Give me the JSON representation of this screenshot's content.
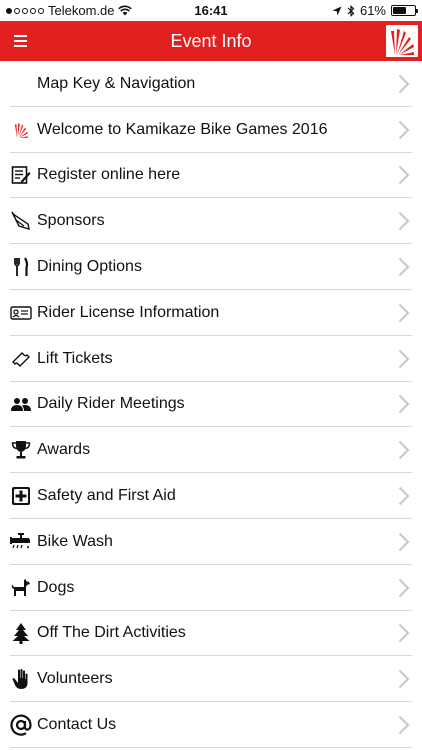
{
  "status_bar": {
    "carrier": "Telekom.de",
    "signal_bars": 1,
    "time": "16:41",
    "battery_percent_label": "61%",
    "battery_level": 0.61
  },
  "nav": {
    "title": "Event Info",
    "menu_icon": "hamburger-icon",
    "logo_icon": "kamikaze-logo-icon"
  },
  "colors": {
    "nav_background": "#e2201f",
    "chevron": "#c8c8c8"
  },
  "items": [
    {
      "label": "Map Key & Navigation",
      "icon": "none"
    },
    {
      "label": "Welcome to Kamikaze Bike Games 2016",
      "icon": "kamikaze-logo-icon"
    },
    {
      "label": "Register online here",
      "icon": "form-icon"
    },
    {
      "label": "Sponsors",
      "icon": "megaphone-icon"
    },
    {
      "label": "Dining Options",
      "icon": "fork-knife-icon"
    },
    {
      "label": "Rider License Information",
      "icon": "id-card-icon"
    },
    {
      "label": "Lift Tickets",
      "icon": "ticket-icon"
    },
    {
      "label": "Daily Rider Meetings",
      "icon": "people-icon"
    },
    {
      "label": "Awards",
      "icon": "trophy-icon"
    },
    {
      "label": "Safety and First Aid",
      "icon": "first-aid-icon"
    },
    {
      "label": "Bike Wash",
      "icon": "faucet-icon"
    },
    {
      "label": "Dogs",
      "icon": "dog-icon"
    },
    {
      "label": "Off The Dirt Activities",
      "icon": "tree-icon"
    },
    {
      "label": "Volunteers",
      "icon": "hand-icon"
    },
    {
      "label": "Contact Us",
      "icon": "at-sign-icon"
    }
  ]
}
